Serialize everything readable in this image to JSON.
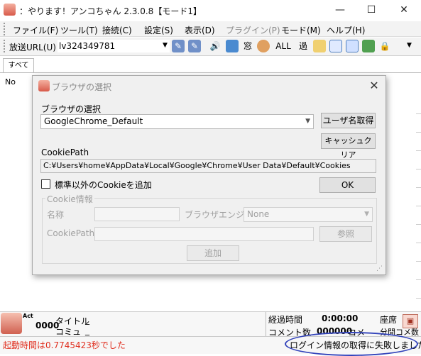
{
  "window": {
    "title": "：やります！アンコちゃん 2.3.0.8【モード1】",
    "controls": {
      "minimize": "—",
      "maximize": "☐",
      "close": "✕"
    }
  },
  "menu": {
    "items": [
      "ファイル(F)",
      "ツール(T)",
      "接続(C)",
      "設定(S)",
      "表示(D)",
      "プラグイン(P)",
      "モード(M)",
      "ヘルプ(H)"
    ]
  },
  "toolbar": {
    "url_label": "放送URL(U)",
    "url_value": "lv324349781",
    "text_buttons": {
      "window": "窓",
      "all": "ALL",
      "over": "過"
    }
  },
  "tabs": {
    "all": "すべて"
  },
  "table": {
    "col_no": "No"
  },
  "dialog": {
    "title": "ブラウザの選択",
    "browser_label": "ブラウザの選択",
    "browser_value": "GoogleChrome_Default",
    "get_user_button": "ユーザ名取得",
    "cache_clear_button": "キャッシュクリア",
    "cookiepath_label": "CookiePath",
    "cookiepath_value": "C:¥Users¥home¥AppData¥Local¥Google¥Chrome¥User Data¥Default¥Cookies",
    "add_cookie_checkbox_label": "標準以外のCookieを追加",
    "ok_button": "OK",
    "group_label": "Cookie情報",
    "name_label": "名称",
    "engine_label": "ブラウザエンジン",
    "engine_value": "None",
    "cookiepath2_label": "CookiePath",
    "browse_button": "参照",
    "add_button": "追加"
  },
  "status": {
    "act_label": "Act",
    "act_count": "0000",
    "title_label": "タイトル",
    "title_value": "_",
    "community_label": "コミュ",
    "community_value": "_",
    "elapsed_label": "経過時間",
    "elapsed_value": "0:00:00",
    "seat_label": "座席",
    "comment_count_label": "コメント数",
    "comment_count_value": "000000",
    "comment_unit": "コメ",
    "per_minute_label": "分間コメ数",
    "boot_time_text": "起動時間は0.7745423秒でした",
    "login_text": "ログイン情報の取得に失敗しました"
  }
}
